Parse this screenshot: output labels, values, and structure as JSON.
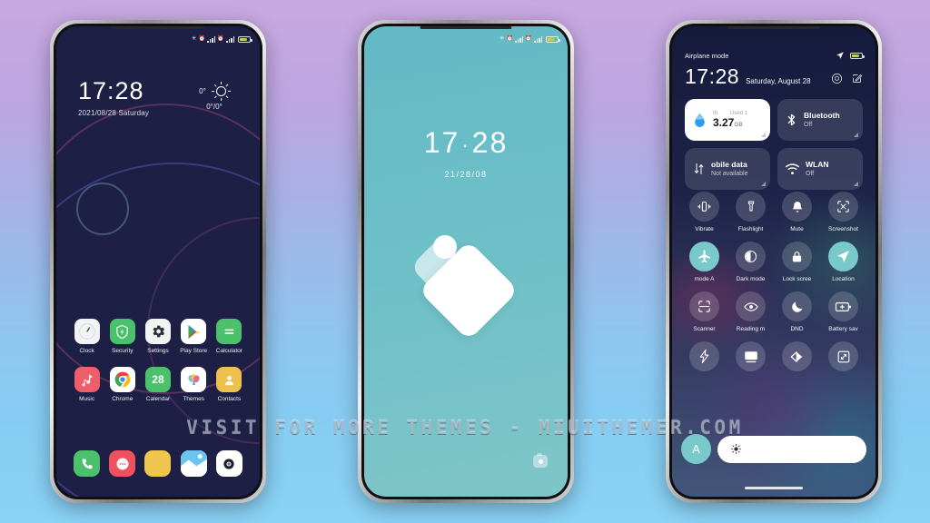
{
  "background": {
    "top_color": "#c9a8e0",
    "bottom_color": "#8ad2f5"
  },
  "watermark": {
    "text": "VISIT FOR MORE THEMES - MIUITHEMER.COM"
  },
  "phone1": {
    "label": "Home screen",
    "statusbar": {
      "icons": [
        "bluetooth-icon",
        "alarm-icon",
        "signal-icon",
        "signal-icon",
        "battery-icon"
      ]
    },
    "clock": {
      "time": "17:28",
      "date": "2021/08/28  Saturday"
    },
    "weather": {
      "current": "0°",
      "range": "0°/0°",
      "icon": "sun-icon"
    },
    "apps_row1": [
      {
        "label": "Clock",
        "icon": "clock-icon",
        "bg": "#f2f3f5"
      },
      {
        "label": "Security",
        "icon": "shield-icon",
        "bg": "#4cc16c"
      },
      {
        "label": "Settings",
        "icon": "gear-icon",
        "bg": "#f2f3f5"
      },
      {
        "label": "Play Store",
        "icon": "play-store-icon",
        "bg": "#ffffff"
      },
      {
        "label": "Calculator",
        "icon": "calculator-icon",
        "bg": "#4cc16c"
      }
    ],
    "apps_row2": [
      {
        "label": "Music",
        "icon": "music-note-icon",
        "bg": "#ef5f6b"
      },
      {
        "label": "Chrome",
        "icon": "chrome-icon",
        "bg": "#ffffff"
      },
      {
        "label": "Calendar",
        "icon": "calendar-icon",
        "bg": "#4cc16c",
        "day": "28"
      },
      {
        "label": "Themes",
        "icon": "themes-icon",
        "bg": "#ffffff"
      },
      {
        "label": "Contacts",
        "icon": "contact-icon",
        "bg": "#f0c košík"
      }
    ],
    "dock": [
      {
        "label": "Phone",
        "icon": "phone-icon",
        "bg": "#4cc16c"
      },
      {
        "label": "Messages",
        "icon": "message-icon",
        "bg": "#f0515e"
      },
      {
        "label": "Notes",
        "icon": "notes-icon",
        "bg": "#efc74e"
      },
      {
        "label": "Gallery",
        "icon": "gallery-icon",
        "bg": "#ffffff"
      },
      {
        "label": "Camera",
        "icon": "camera-icon",
        "bg": "#ffffff"
      }
    ]
  },
  "phone2": {
    "label": "Lock screen",
    "statusbar": {
      "icons": [
        "bluetooth-icon",
        "alarm-icon",
        "signal-icon",
        "signal-icon",
        "battery-icon"
      ]
    },
    "time_hours": "17",
    "time_sep": "·",
    "time_minutes": "28",
    "date": "21/28/08",
    "wallpaper_accent": "#6ec0c8",
    "camera_shortcut": "camera-icon"
  },
  "phone3": {
    "label": "Control center",
    "statusbar_left": "Airplane mode",
    "statusbar_icons": [
      "location-arrow-icon",
      "battery-icon"
    ],
    "time": "17:28",
    "date": "Saturday, August 28",
    "actions": [
      "settings-shortcut-icon",
      "edit-icon"
    ],
    "big_tiles": [
      {
        "name": "data-usage",
        "style": "light",
        "icon": "water-drop-icon",
        "head_left": "th",
        "head_right": "Used 1",
        "value": "3.27",
        "unit": "GB"
      },
      {
        "name": "bluetooth",
        "style": "dark",
        "icon": "bluetooth-icon",
        "title": "Bluetooth",
        "sub": "Off"
      },
      {
        "name": "mobile-data",
        "style": "dark",
        "icon": "data-transfer-icon",
        "title": "obile data",
        "sub": "Not available"
      },
      {
        "name": "wlan",
        "style": "dark",
        "icon": "wifi-icon",
        "title": "WLAN",
        "sub": "Off"
      }
    ],
    "toggles": [
      {
        "label": "Vibrate",
        "icon": "vibrate-icon",
        "on": false
      },
      {
        "label": "Flashlight",
        "icon": "flashlight-icon",
        "on": false
      },
      {
        "label": "Mute",
        "icon": "bell-icon",
        "on": false
      },
      {
        "label": "Screenshot",
        "icon": "screenshot-icon",
        "on": false
      },
      {
        "label": "mode    A",
        "icon": "airplane-icon",
        "on": true
      },
      {
        "label": "Dark mode",
        "icon": "contrast-icon",
        "on": false
      },
      {
        "label": "Lock scree",
        "icon": "lock-icon",
        "on": false
      },
      {
        "label": "Location",
        "icon": "location-arrow-icon",
        "on": true
      },
      {
        "label": "Scanner",
        "icon": "scan-icon",
        "on": false
      },
      {
        "label": "Reading m",
        "icon": "eye-icon",
        "on": false
      },
      {
        "label": "DND",
        "icon": "moon-icon",
        "on": false
      },
      {
        "label": "Battery sav",
        "icon": "battery-plus-icon",
        "on": false
      },
      {
        "label": "",
        "icon": "bolt-icon",
        "on": false
      },
      {
        "label": "",
        "icon": "cast-icon",
        "on": false
      },
      {
        "label": "",
        "icon": "color-invert-icon",
        "on": false
      },
      {
        "label": "",
        "icon": "expand-icon",
        "on": false
      }
    ],
    "brightness": {
      "auto_label": "A",
      "slider_icon": "brightness-icon"
    }
  }
}
